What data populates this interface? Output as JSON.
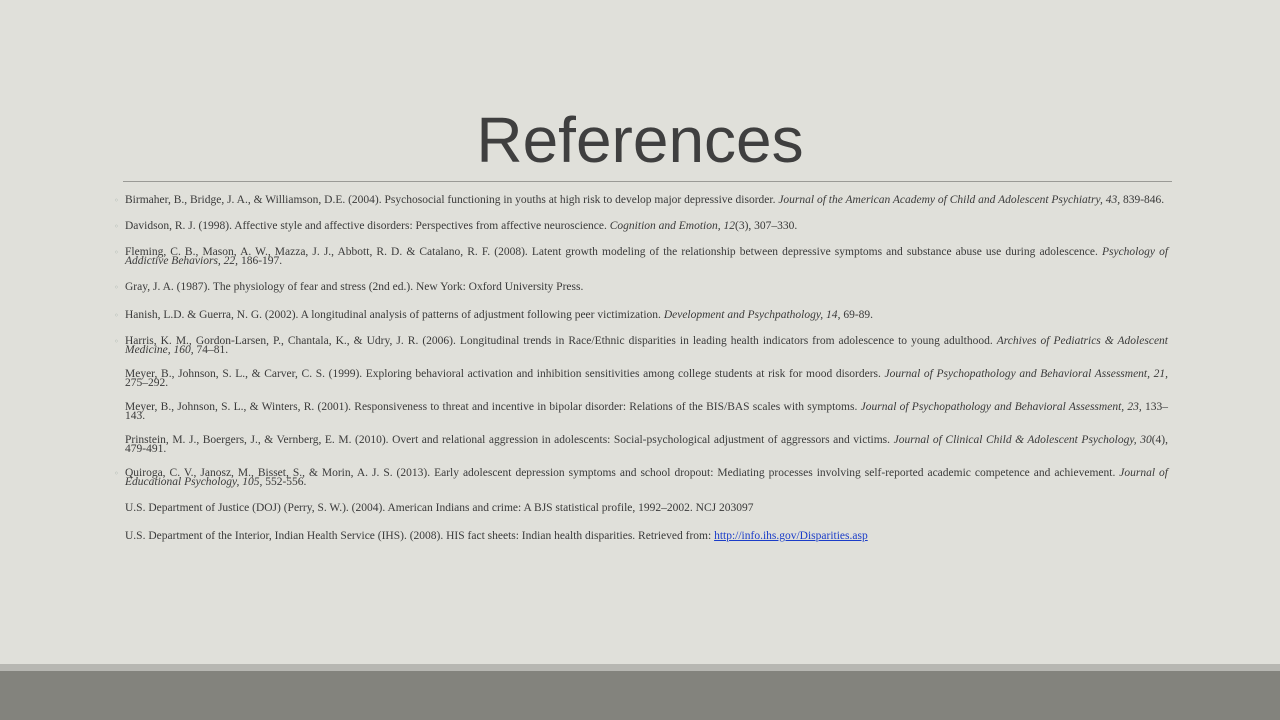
{
  "slide": {
    "title": "References",
    "bullet_glyph": "◦",
    "references": [
      {
        "bullet": true,
        "lines": 2,
        "parts": [
          {
            "t": "Birmaher, B., Bridge, J. A., & Williamson, D.E. (2004). Psychosocial functioning in youths at high risk to develop major depressive disorder. "
          },
          {
            "t": "Journal of the American Academy of Child and Adolescent Psychiatry, 43,",
            "i": true
          },
          {
            "t": " 839-846."
          }
        ]
      },
      {
        "bullet": true,
        "lines": 1,
        "parts": [
          {
            "t": "Davidson, R. J. (1998). Affective style and affective disorders: Perspectives from affective neuroscience. "
          },
          {
            "t": "Cognition and Emotion, 12",
            "i": true
          },
          {
            "t": "(3), 307–330."
          }
        ]
      },
      {
        "bullet": true,
        "lines": 2,
        "parts": [
          {
            "t": "Fleming, C. B., Mason, A. W., Mazza, J. J., Abbott, R. D. & Catalano, R. F. (2008). Latent growth modeling of the relationship between depressive symptoms and substance abuse use during adolescence. "
          },
          {
            "t": "Psychology of Addictive Behaviors, 22,",
            "i": true
          },
          {
            "t": " 186-197."
          }
        ]
      },
      {
        "bullet": true,
        "lines": 1,
        "parts": [
          {
            "t": "Gray, J. A. (1987). The physiology of fear and stress (2nd ed.). New York: Oxford University Press."
          }
        ]
      },
      {
        "bullet": true,
        "lines": 1,
        "parts": [
          {
            "t": "Hanish, L.D. & Guerra, N. G. (2002). A longitudinal analysis of patterns of adjustment following peer victimization. "
          },
          {
            "t": "Development and Psychpathology, 14",
            "i": true
          },
          {
            "t": ", 69-89."
          }
        ]
      },
      {
        "bullet": true,
        "lines": 2,
        "parts": [
          {
            "t": "Harris, K. M., Gordon-Larsen, P., Chantala, K., & Udry, J. R. (2006). Longitudinal trends in Race/Ethnic disparities in leading health indicators from adolescence to young adulthood. "
          },
          {
            "t": "Archives of Pediatrics & Adolescent Medicine, 160,",
            "i": true
          },
          {
            "t": " 74–81."
          }
        ]
      },
      {
        "bullet": false,
        "lines": 2,
        "parts": [
          {
            "t": "Meyer, B., Johnson, S. L., & Carver, C. S. (1999). Exploring behavioral activation and inhibition sensitivities among college students at risk for mood disorders. "
          },
          {
            "t": "Journal of Psychopathology and Behavioral Assessment, 21,",
            "i": true
          },
          {
            "t": " 275–292."
          }
        ]
      },
      {
        "bullet": false,
        "lines": 2,
        "parts": [
          {
            "t": "Meyer, B., Johnson, S. L., & Winters, R. (2001). Responsiveness to threat and incentive in bipolar disorder: Relations of the BIS/BAS scales with symptoms. "
          },
          {
            "t": "Journal of Psychopathology and Behavioral Assessment, 23,",
            "i": true
          },
          {
            "t": " 133–143."
          }
        ]
      },
      {
        "bullet": false,
        "lines": 2,
        "parts": [
          {
            "t": "Prinstein, M. J., Boergers, J., & Vernberg, E. M. (2010). Overt and relational aggression in adolescents: Social-psychological adjustment of aggressors and victims. "
          },
          {
            "t": "Journal of Clinical Child & Adolescent Psychology, 30",
            "i": true
          },
          {
            "t": "(4), 479-491."
          }
        ]
      },
      {
        "bullet": true,
        "lines": 2,
        "parts": [
          {
            "t": "Quiroga, C. V., Janosz, M., Bisset, S., & Morin, A. J. S. (2013). Early adolescent depression symptoms and school dropout: Mediating processes involving self-reported academic competence and achievement. "
          },
          {
            "t": "Journal of Educational Psychology, 105,",
            "i": true
          },
          {
            "t": " 552-556."
          }
        ]
      },
      {
        "bullet": false,
        "lines": 1,
        "parts": [
          {
            "t": "U.S. Department of Justice (DOJ) (Perry, S. W.). (2004). American Indians and crime: A BJS statistical profile, 1992–2002. NCJ 203097"
          }
        ]
      },
      {
        "bullet": false,
        "lines": 1,
        "parts": [
          {
            "t": "U.S. Department of the Interior, Indian Health Service (IHS). (2008). HIS fact sheets: Indian health disparities. Retrieved from: "
          },
          {
            "t": "http://info.ihs.gov/Disparities.asp",
            "link": true
          }
        ]
      }
    ]
  }
}
